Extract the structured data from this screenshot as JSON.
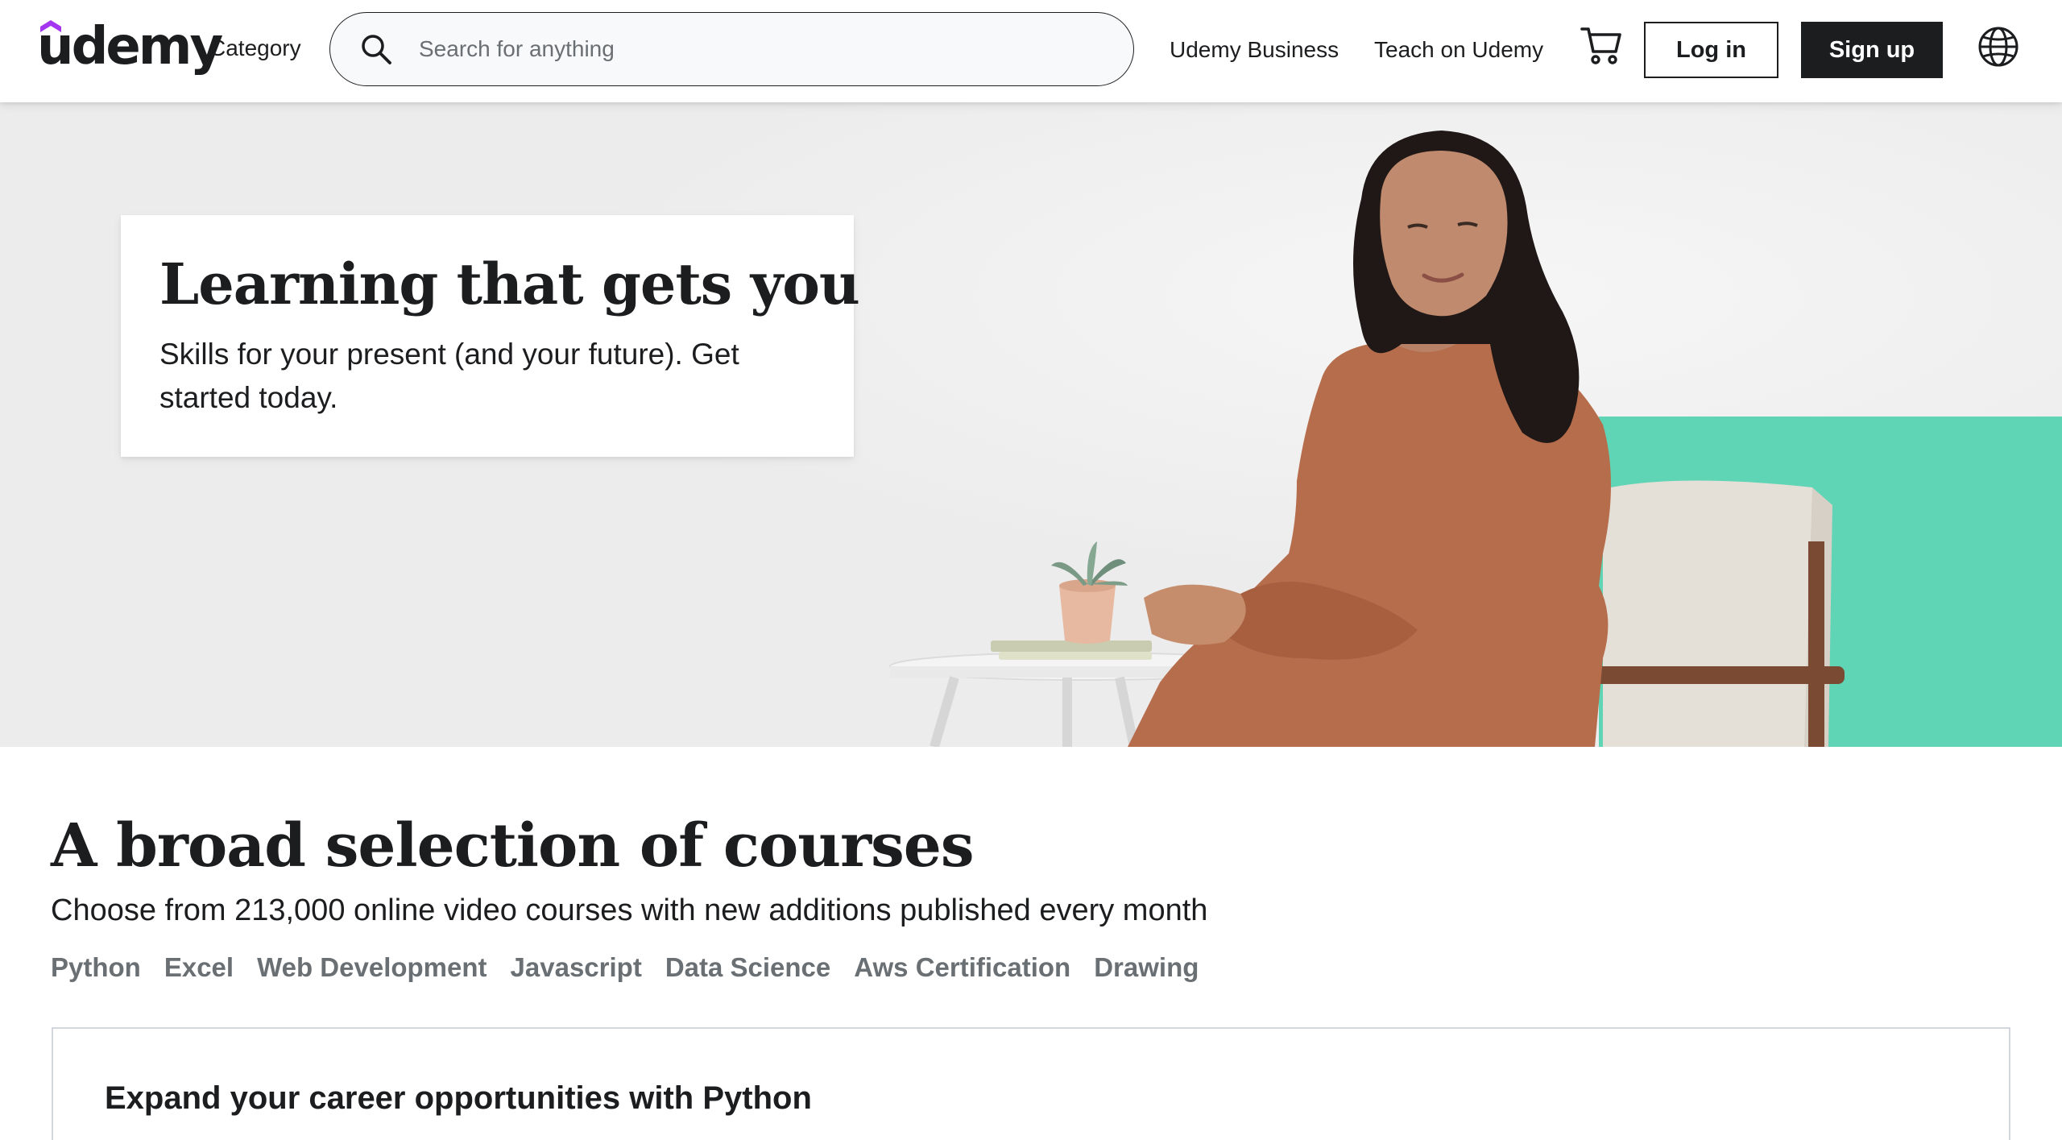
{
  "brand": {
    "name": "udemy",
    "accent_color": "#a435f0"
  },
  "header": {
    "category_label": "Category",
    "search": {
      "placeholder": "Search for anything",
      "value": "",
      "icon": "search-icon"
    },
    "business_link": "Udemy Business",
    "teach_link": "Teach on Udemy",
    "cart_icon": "cart-icon",
    "login_label": "Log in",
    "signup_label": "Sign up",
    "language_icon": "globe-icon"
  },
  "hero": {
    "title": "Learning that gets you",
    "subtitle": "Skills for your present (and your future). Get started today.",
    "accent_color": "#5fd5b6"
  },
  "courses": {
    "title": "A broad selection of courses",
    "subtitle": "Choose from 213,000 online video courses with new additions published every month",
    "tabs": [
      {
        "label": "Python"
      },
      {
        "label": "Excel"
      },
      {
        "label": "Web Development"
      },
      {
        "label": "Javascript"
      },
      {
        "label": "Data Science"
      },
      {
        "label": "Aws Certification"
      },
      {
        "label": "Drawing"
      }
    ],
    "panel_title": "Expand your career opportunities with Python"
  }
}
